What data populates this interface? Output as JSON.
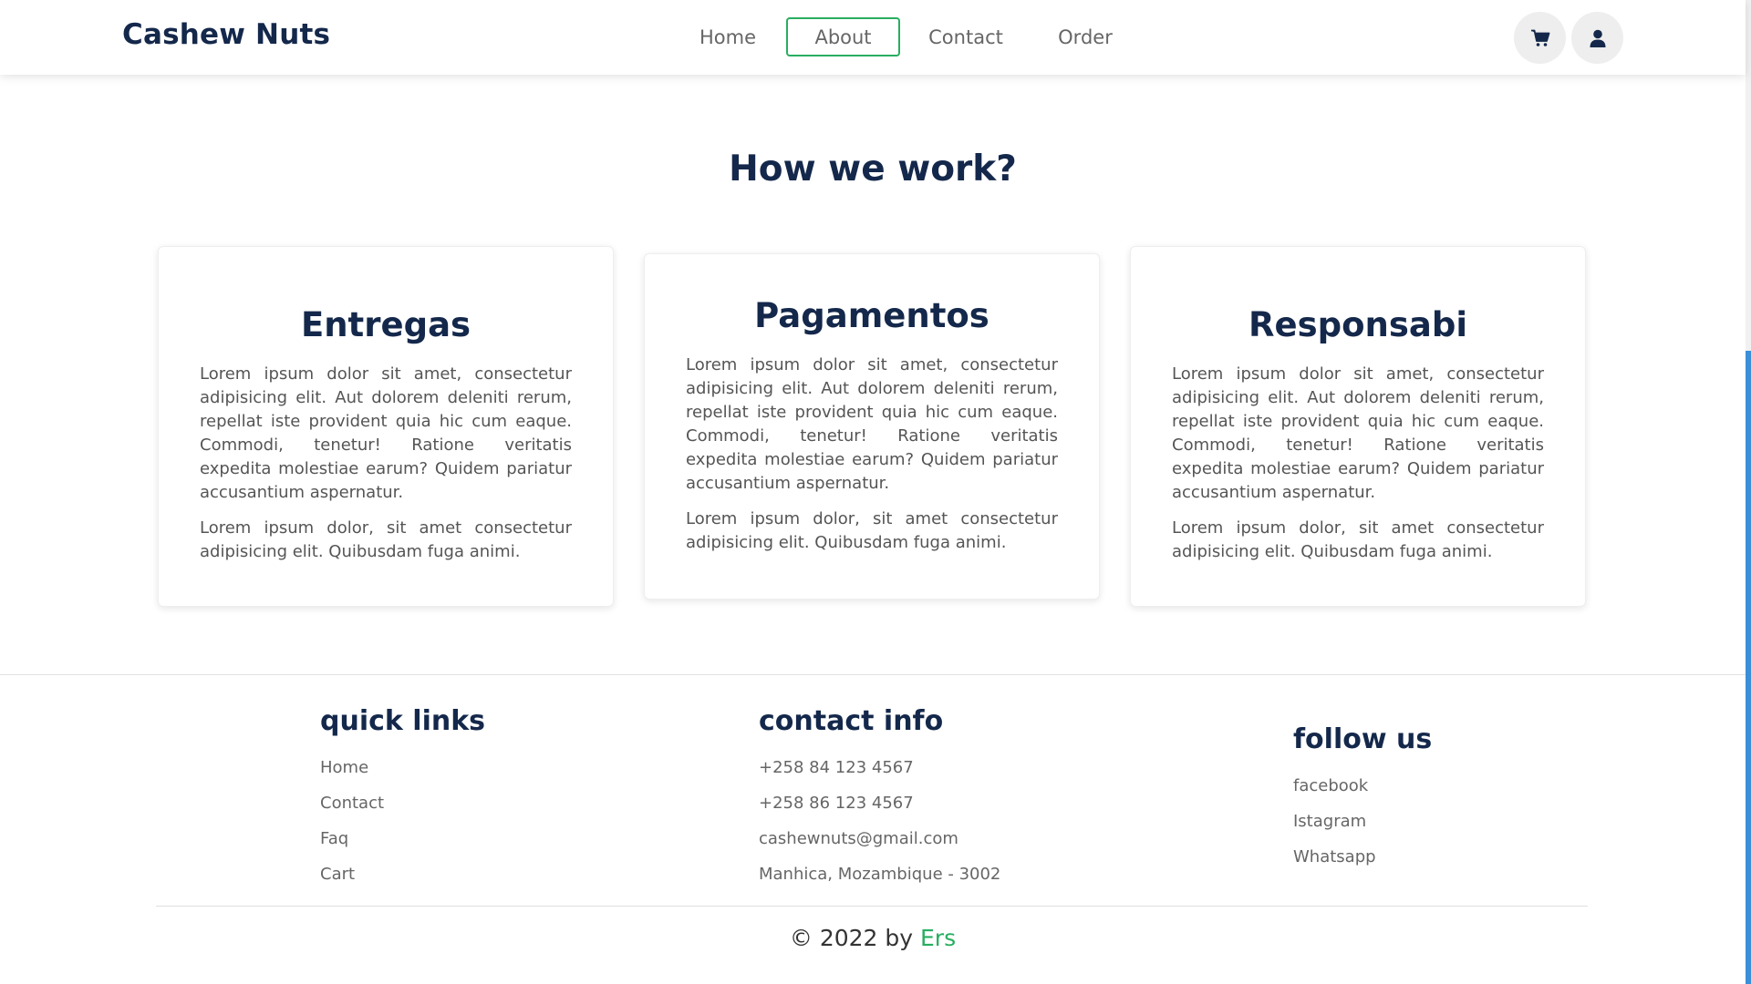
{
  "header": {
    "logo": "Cashew Nuts",
    "nav": [
      {
        "label": "Home"
      },
      {
        "label": "About",
        "active": true
      },
      {
        "label": "Contact"
      },
      {
        "label": "Order"
      }
    ],
    "icons": [
      "cart-icon",
      "user-icon"
    ]
  },
  "section": {
    "title": "How we work?",
    "cards": [
      {
        "title": "Entregas",
        "p1": "Lorem ipsum dolor sit amet, consectetur adipisicing elit. Aut dolorem deleniti rerum, repellat iste provident quia hic cum eaque. Commodi, tenetur! Ratione veritatis expedita molestiae earum? Quidem pariatur accusantium aspernatur.",
        "p2": "Lorem ipsum dolor, sit amet consectetur adipisicing elit. Quibusdam fuga animi."
      },
      {
        "title": "Pagamentos",
        "p1": "Lorem ipsum dolor sit amet, consectetur adipisicing elit. Aut dolorem deleniti rerum, repellat iste provident quia hic cum eaque. Commodi, tenetur! Ratione veritatis expedita molestiae earum? Quidem pariatur accusantium aspernatur.",
        "p2": "Lorem ipsum dolor, sit amet consectetur adipisicing elit. Quibusdam fuga animi."
      },
      {
        "title": "Responsabi",
        "p1": "Lorem ipsum dolor sit amet, consectetur adipisicing elit. Aut dolorem deleniti rerum, repellat iste provident quia hic cum eaque. Commodi, tenetur! Ratione veritatis expedita molestiae earum? Quidem pariatur accusantium aspernatur.",
        "p2": "Lorem ipsum dolor, sit amet consectetur adipisicing elit. Quibusdam fuga animi."
      }
    ]
  },
  "footer": {
    "quick_links": {
      "title": "quick links",
      "items": [
        "Home",
        "Contact",
        "Faq",
        "Cart"
      ]
    },
    "contact_info": {
      "title": "contact info",
      "items": [
        "+258 84 123 4567",
        "+258 86 123 4567",
        "cashewnuts@gmail.com",
        "Manhica, Mozambique - 3002"
      ]
    },
    "follow_us": {
      "title": "follow us",
      "items": [
        "facebook",
        "Istagram",
        "Whatsapp"
      ]
    },
    "credit_prefix": "© 2022 by",
    "credit_brand": "Ers"
  },
  "colors": {
    "heading": "#14284b",
    "accent": "#27ae60",
    "scroll_thumb": "#3a8fd8"
  }
}
